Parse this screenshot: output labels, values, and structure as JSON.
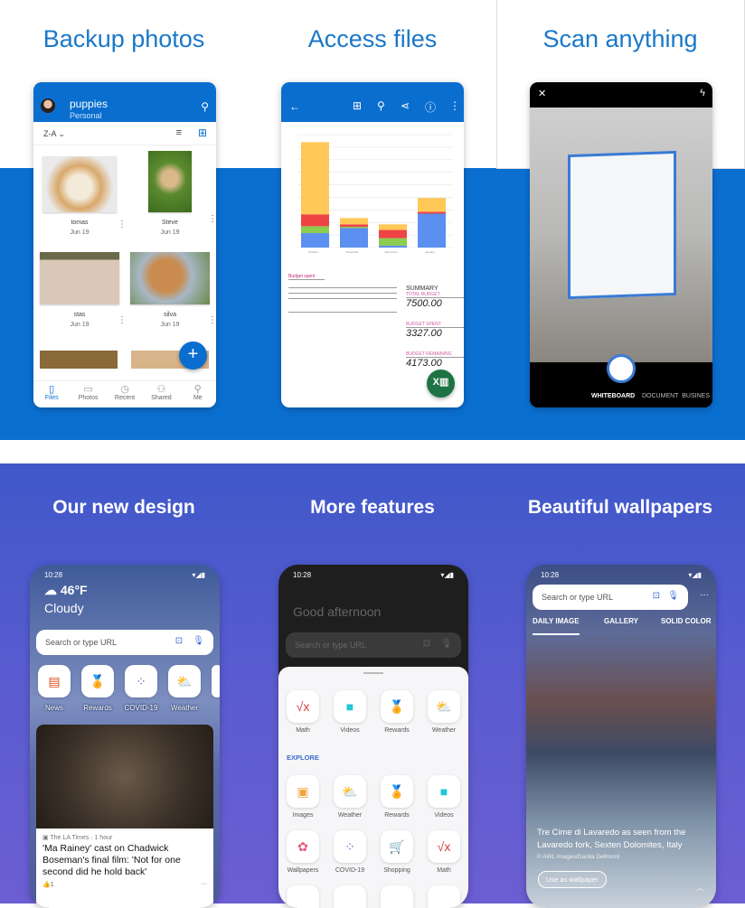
{
  "colors": {
    "brand_blue": "#0b6fd0",
    "purple_top": "#3f58c9",
    "purple_bottom": "#6b5ed2"
  },
  "headings": {
    "backup": "Backup photos",
    "access": "Access files",
    "scan": "Scan anything",
    "design": "Our new design",
    "features": "More features",
    "wallpapers": "Beautiful wallpapers"
  },
  "onedrive": {
    "folder": "puppies",
    "account": "Personal",
    "sort": "Z-A",
    "sort_icon": "chevron-down-icon",
    "photos": [
      {
        "name": "tomas",
        "date": "Jun 19"
      },
      {
        "name": "Steve",
        "date": "Jun 19"
      },
      {
        "name": "stas",
        "date": "Jun 19"
      },
      {
        "name": "silva",
        "date": "Jun 19"
      }
    ],
    "nav": [
      {
        "label": "Files",
        "icon": "file-icon"
      },
      {
        "label": "Photos",
        "icon": "image-icon"
      },
      {
        "label": "Recent",
        "icon": "clock-icon"
      },
      {
        "label": "Shared",
        "icon": "people-icon"
      },
      {
        "label": "Me",
        "icon": "person-icon"
      }
    ],
    "add": "+"
  },
  "excel": {
    "chart": {
      "type": "bar",
      "stacked": true,
      "categories": [
        "October",
        "November",
        "December",
        "January"
      ],
      "ylim": [
        0,
        1800
      ],
      "series": [
        {
          "color": "#5b8ff0",
          "values": [
            230,
            310,
            30,
            540
          ]
        },
        {
          "color": "#8ccc4f",
          "values": [
            110,
            20,
            120,
            0
          ]
        },
        {
          "color": "#ee4444",
          "values": [
            190,
            40,
            130,
            30
          ]
        },
        {
          "color": "#ffc857",
          "values": [
            1150,
            100,
            90,
            220
          ]
        }
      ]
    },
    "summary": {
      "title": "SUMMARY",
      "items": [
        {
          "label": "TOTAL BUDGET",
          "value": "7500.00"
        },
        {
          "label": "BUDGET SPENT",
          "value": "3327.00"
        },
        {
          "label": "BUDGET REMAINING",
          "value": "4173.00"
        }
      ]
    },
    "table_title": "Budget spent"
  },
  "scan": {
    "modes": [
      "WHITEBOARD",
      "DOCUMENT",
      "BUSINES"
    ]
  },
  "edge1": {
    "time": "10:28",
    "temp": "46°F",
    "condition": "Cloudy",
    "search_placeholder": "Search or type URL",
    "tiles": [
      "News",
      "Rewards",
      "COVID-19",
      "Weather"
    ],
    "news": {
      "source": "The LA Times · 1 hour",
      "headline": "'Ma Rainey' cast on Chadwick Boseman's final film: 'Not for one second did he hold back'",
      "likes": "1",
      "more": "···"
    }
  },
  "edge2": {
    "time": "10:28",
    "greeting": "Good afternoon",
    "search_placeholder": "Search or type URL",
    "top": [
      "Math",
      "Videos",
      "Rewards",
      "Weather"
    ],
    "explore": "EXPLORE",
    "explore_items": [
      "Images",
      "Weather",
      "Rewards",
      "Videos",
      "Wallpapers",
      "COVID-19",
      "Shopping",
      "Math"
    ]
  },
  "edge3": {
    "time": "10:28",
    "search_placeholder": "Search or type URL",
    "tabs": [
      "DAILY IMAGE",
      "GALLERY",
      "SOLID COLOR"
    ],
    "caption": "Tre Cime di Lavaredo as seen from the Lavaredo fork, Sexten Dolomites, Italy",
    "credit": "© AWL Images/Danita Dellmont",
    "button": "Use as wallpaper",
    "more": "···"
  }
}
